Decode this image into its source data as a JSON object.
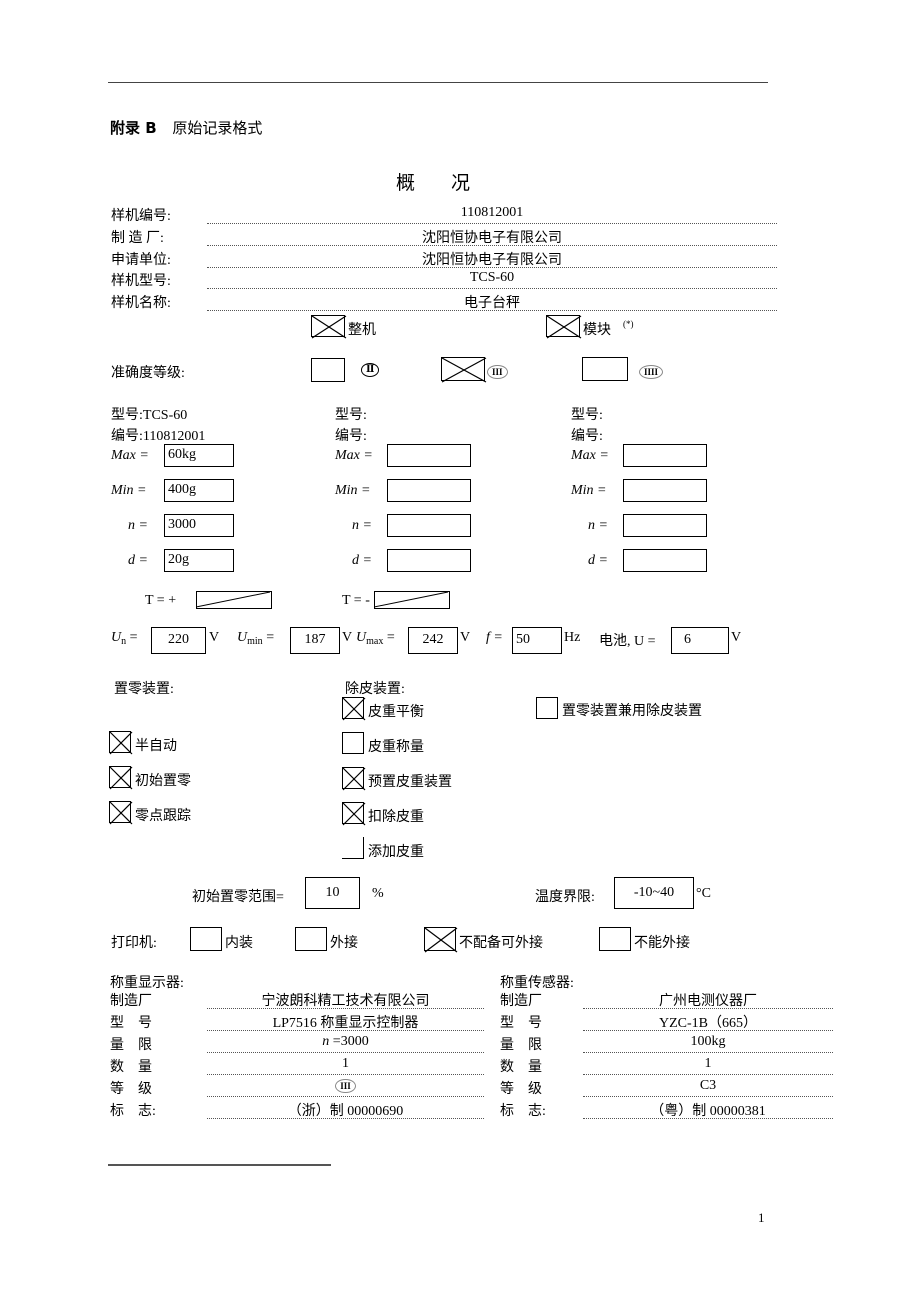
{
  "header": {
    "appendix": "附录 B",
    "title": "原始记录格式"
  },
  "section_title": "概况",
  "overview": [
    {
      "label": "样机编号:",
      "value": "110812001"
    },
    {
      "label": "制 造 厂:",
      "value": "沈阳恒协电子有限公司"
    },
    {
      "label": "申请单位:",
      "value": "沈阳恒协电子有限公司"
    },
    {
      "label": "样机型号:",
      "value": "TCS-60"
    },
    {
      "label": "样机名称:",
      "value": "电子台秤"
    }
  ],
  "type_options": [
    {
      "label": "整机",
      "checked": true
    },
    {
      "label": "模块",
      "note": "(*)",
      "checked": true
    }
  ],
  "accuracy": {
    "label": "准确度等级:",
    "options": [
      {
        "symbol": "Ⅱ",
        "checked": false
      },
      {
        "symbol": "III",
        "checked": true
      },
      {
        "symbol": "IIII",
        "checked": false
      }
    ]
  },
  "instruments": [
    {
      "model_label": "型号:",
      "model": "TCS-60",
      "serial_label": "编号:",
      "serial": "110812001",
      "max": "60kg",
      "min": "400g",
      "n": "3000",
      "d": "20g"
    },
    {
      "model_label": "型号:",
      "model": "",
      "serial_label": "编号:",
      "serial": "",
      "max": "",
      "min": "",
      "n": "",
      "d": ""
    },
    {
      "model_label": "型号:",
      "model": "",
      "serial_label": "编号:",
      "serial": "",
      "max": "",
      "min": "",
      "n": "",
      "d": ""
    }
  ],
  "param_labels": {
    "max": "Max =",
    "min": "Min =",
    "n": "n =",
    "d": "d ="
  },
  "tare": {
    "plus_label": "T = +",
    "minus_label": "T = -"
  },
  "power": {
    "un_label": "U",
    "un_sub": "n",
    "un": "220",
    "un_unit": "V",
    "umin_label": "U",
    "umin_sub": "min",
    "umin": "187",
    "umin_unit": "V",
    "umax_label": "U",
    "umax_sub": "max",
    "umax": "242",
    "umax_unit": "V",
    "f_label": "f =",
    "f": "50",
    "f_unit": "Hz",
    "battery_label": "电池, U =",
    "battery": "6",
    "battery_unit": "V"
  },
  "zero_device": {
    "label": "置零装置:",
    "items": [
      {
        "label": "半自动",
        "checked": true
      },
      {
        "label": "初始置零",
        "checked": true
      },
      {
        "label": "零点跟踪",
        "checked": true
      }
    ]
  },
  "tare_device": {
    "label": "除皮装置:",
    "items": [
      {
        "label": "皮重平衡",
        "checked": true
      },
      {
        "label": "皮重称量",
        "checked": false
      },
      {
        "label": "预置皮重装置",
        "checked": true
      },
      {
        "label": "扣除皮重",
        "checked": true
      },
      {
        "label": "添加皮重",
        "checked": false
      }
    ],
    "combined": {
      "label": "置零装置兼用除皮装置",
      "checked": false
    }
  },
  "initial_zero_range": {
    "label": "初始置零范围=",
    "value": "10",
    "unit": "%"
  },
  "temperature": {
    "label": "温度界限:",
    "value": "-10~40",
    "unit": "°C"
  },
  "printer": {
    "label": "打印机:",
    "options": [
      {
        "label": "内装",
        "checked": false
      },
      {
        "label": "外接",
        "checked": false
      },
      {
        "label": "不配备可外接",
        "checked": true
      },
      {
        "label": "不能外接",
        "checked": false
      }
    ]
  },
  "indicator": {
    "title": "称重显示器:",
    "rows": [
      {
        "label": "制造厂",
        "value": "宁波朗科精工技术有限公司"
      },
      {
        "label": "型　号",
        "value": "LP7516 称重显示控制器"
      },
      {
        "label": "量　限",
        "value": "n =3000"
      },
      {
        "label": "数　量",
        "value": "1"
      },
      {
        "label": "等　级",
        "value": "III"
      },
      {
        "label": "标　志:",
        "value": "（浙）制 00000690"
      }
    ]
  },
  "load_cell": {
    "title": "称重传感器:",
    "rows": [
      {
        "label": "制造厂",
        "value": "广州电测仪器厂"
      },
      {
        "label": "型　号",
        "value": "YZC-1B（665）"
      },
      {
        "label": "量　限",
        "value": "100kg"
      },
      {
        "label": "数　量",
        "value": "1"
      },
      {
        "label": "等　级",
        "value": "C3"
      },
      {
        "label": "标　志:",
        "value": "（粤）制 00000381"
      }
    ]
  },
  "page_number": "1"
}
